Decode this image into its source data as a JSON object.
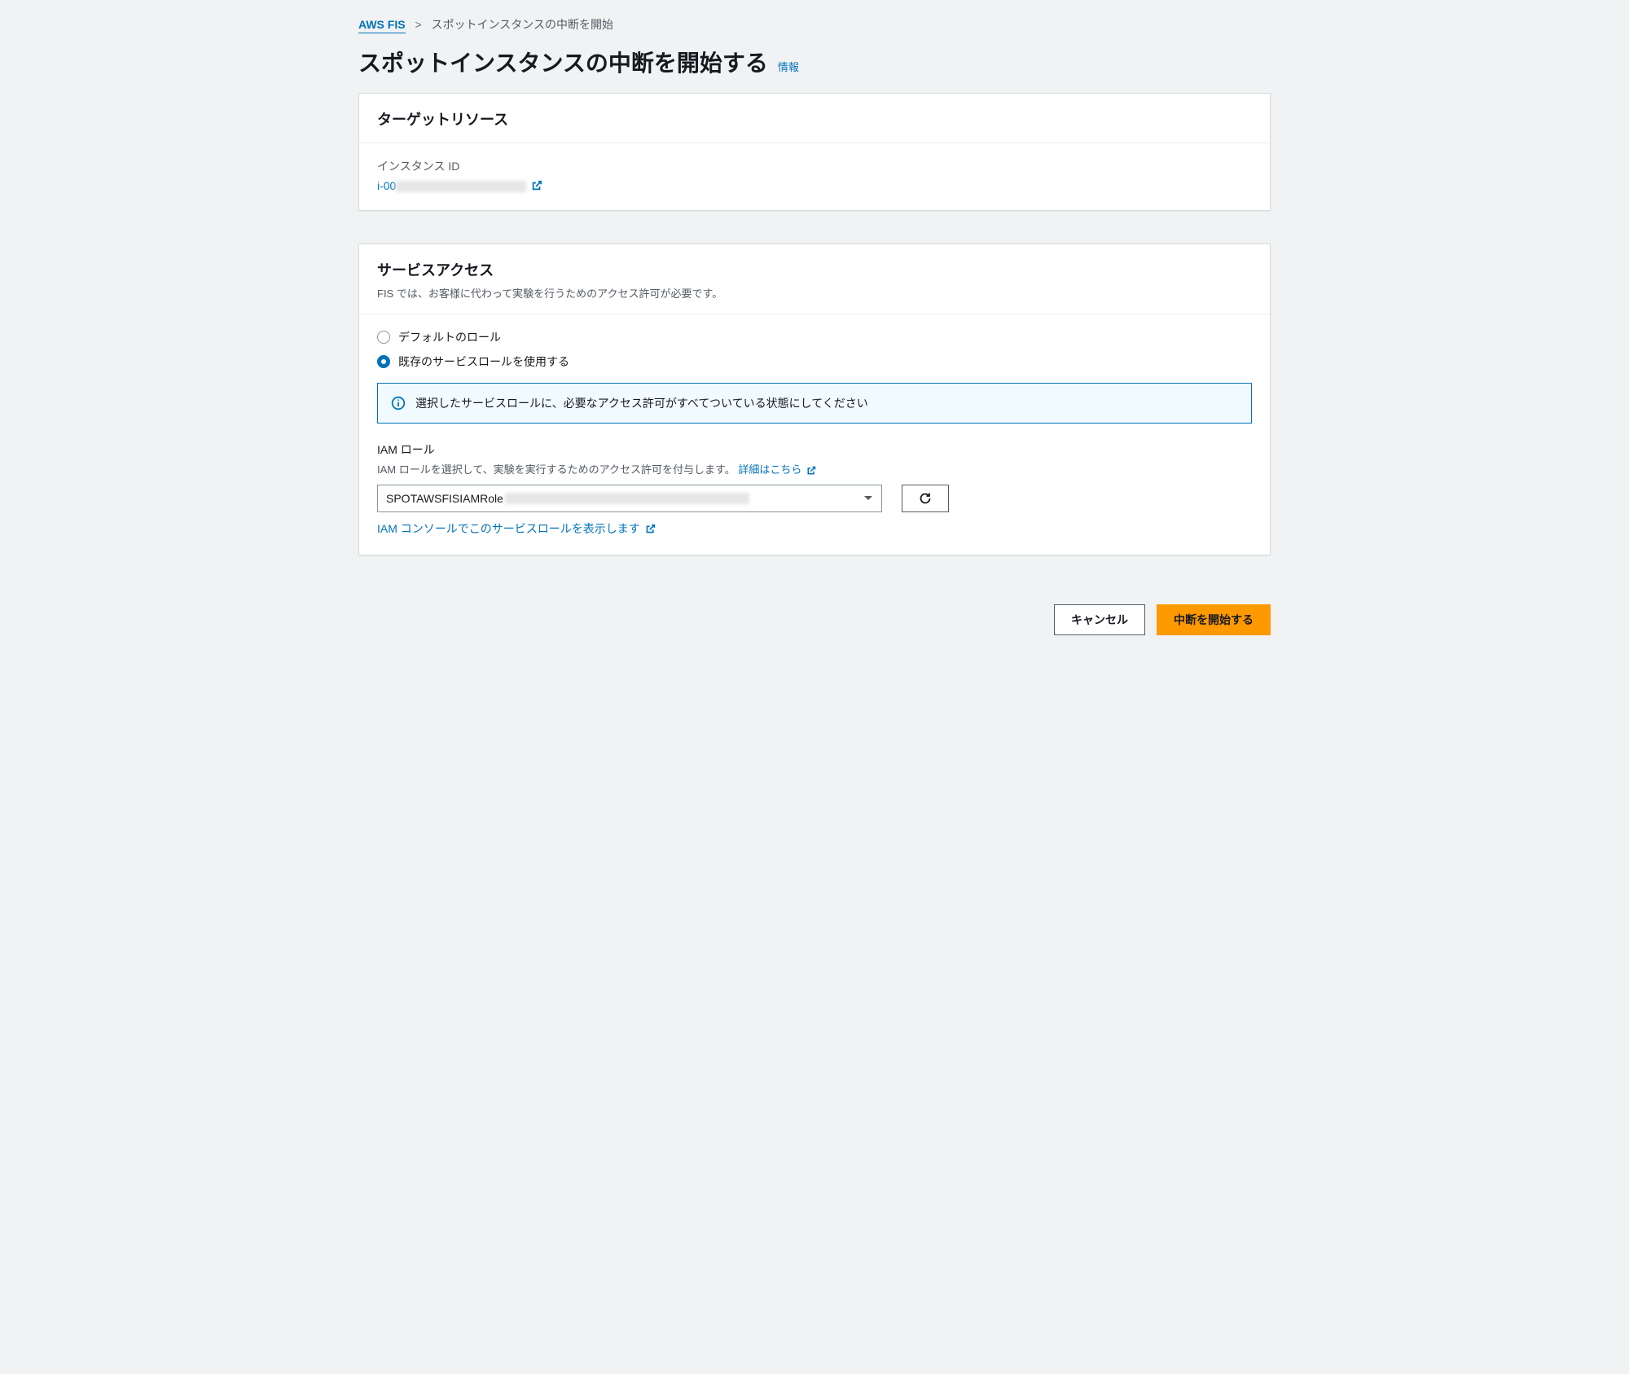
{
  "breadcrumb": {
    "root": "AWS FIS",
    "current": "スポットインスタンスの中断を開始"
  },
  "page": {
    "title": "スポットインスタンスの中断を開始する",
    "info_label": "情報"
  },
  "target_panel": {
    "title": "ターゲットリソース",
    "instance_id_label": "インスタンス ID",
    "instance_id_prefix": "i-00"
  },
  "service_access_panel": {
    "title": "サービスアクセス",
    "subtitle": "FIS では、お客様に代わって実験を行うためのアクセス許可が必要です。",
    "radio_default": "デフォルトのロール",
    "radio_existing": "既存のサービスロールを使用する",
    "banner_text": "選択したサービスロールに、必要なアクセス許可がすべてついている状態にしてください",
    "iam_role_label": "IAM ロール",
    "iam_role_desc": "IAM ロールを選択して、実験を実行するためのアクセス許可を付与します。",
    "learn_more": "詳細はこちら",
    "selected_role_prefix": "SPOTAWSFISIAMRole",
    "view_in_console": "IAM コンソールでこのサービスロールを表示します"
  },
  "footer": {
    "cancel": "キャンセル",
    "start": "中断を開始する"
  }
}
